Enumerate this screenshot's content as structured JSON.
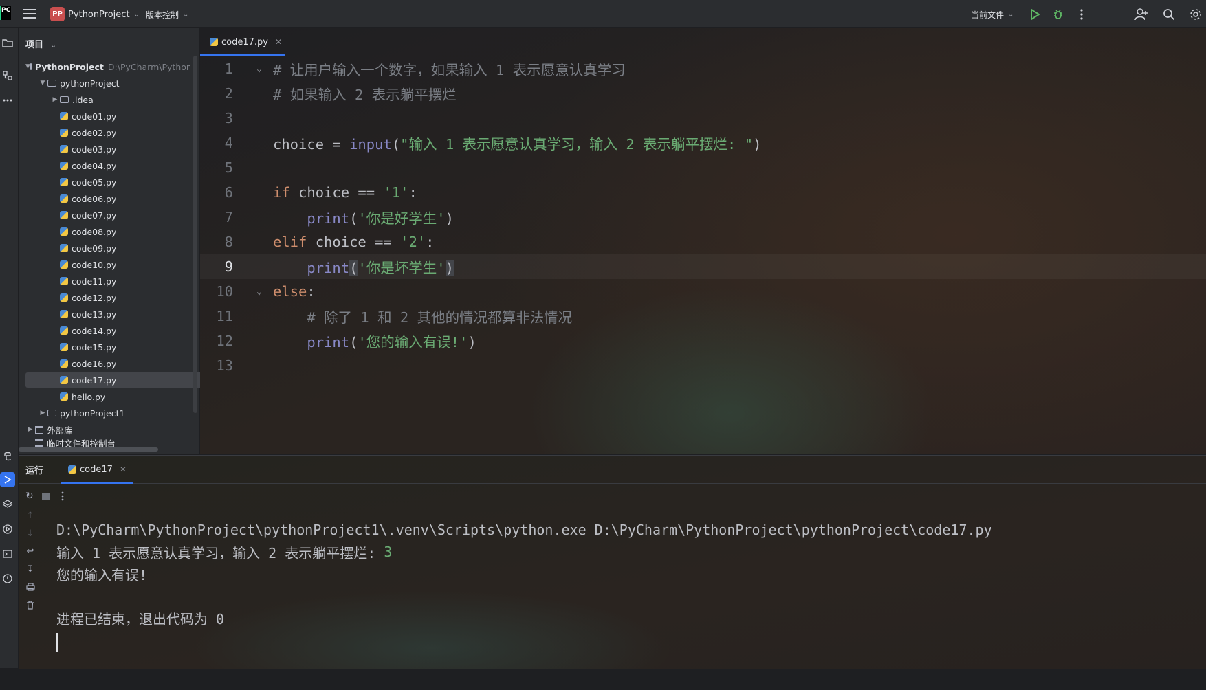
{
  "titlebar": {
    "logo": "PC",
    "project_badge": "PP",
    "project_name": "PythonProject",
    "vcs_label": "版本控制",
    "current_file_label": "当前文件",
    "icons": [
      "hamburger-menu-icon",
      "run-icon",
      "debug-icon",
      "more-vertical-icon",
      "add-user-icon",
      "search-icon",
      "settings-icon"
    ]
  },
  "project_panel": {
    "header": "项目",
    "root": {
      "name": "PythonProject",
      "path": "D:\\PyCharm\\PythonP"
    },
    "items": [
      {
        "label": "pythonProject",
        "kind": "folder",
        "expanded": true
      },
      {
        "label": ".idea",
        "kind": "folder",
        "expanded": false
      },
      {
        "label": "code01.py",
        "kind": "py"
      },
      {
        "label": "code02.py",
        "kind": "py"
      },
      {
        "label": "code03.py",
        "kind": "py"
      },
      {
        "label": "code04.py",
        "kind": "py"
      },
      {
        "label": "code05.py",
        "kind": "py"
      },
      {
        "label": "code06.py",
        "kind": "py"
      },
      {
        "label": "code07.py",
        "kind": "py"
      },
      {
        "label": "code08.py",
        "kind": "py"
      },
      {
        "label": "code09.py",
        "kind": "py"
      },
      {
        "label": "code10.py",
        "kind": "py"
      },
      {
        "label": "code11.py",
        "kind": "py"
      },
      {
        "label": "code12.py",
        "kind": "py"
      },
      {
        "label": "code13.py",
        "kind": "py"
      },
      {
        "label": "code14.py",
        "kind": "py"
      },
      {
        "label": "code15.py",
        "kind": "py"
      },
      {
        "label": "code16.py",
        "kind": "py"
      },
      {
        "label": "code17.py",
        "kind": "py",
        "selected": true
      },
      {
        "label": "hello.py",
        "kind": "py"
      },
      {
        "label": "pythonProject1",
        "kind": "folder",
        "expanded": false
      },
      {
        "label": "外部库",
        "kind": "library",
        "expanded": false
      },
      {
        "label": "临时文件和控制台",
        "kind": "scratch"
      }
    ]
  },
  "editor": {
    "tab_label": "code17.py",
    "current_line": 9,
    "lines": [
      {
        "n": "1",
        "text": "# 让用户输入一个数字，如果输入 1 表示愿意认真学习"
      },
      {
        "n": "2",
        "text": "# 如果输入 2 表示躺平摆烂"
      },
      {
        "n": "3",
        "text": ""
      },
      {
        "n": "4",
        "var": "choice",
        "op": " = ",
        "fn": "input",
        "open": "(",
        "str": "\"输入 1 表示愿意认真学习，输入 2 表示躺平摆烂: \"",
        "close": ")"
      },
      {
        "n": "5",
        "text": ""
      },
      {
        "n": "6",
        "kw": "if",
        "rest": " choice == ",
        "str": "'1'",
        "tail": ":"
      },
      {
        "n": "7",
        "indent": "    ",
        "fn": "print",
        "open": "(",
        "str": "'你是好学生'",
        "close": ")"
      },
      {
        "n": "8",
        "kw": "elif",
        "rest": " choice == ",
        "str": "'2'",
        "tail": ":"
      },
      {
        "n": "9",
        "indent": "    ",
        "fn": "print",
        "open": "(",
        "str": "'你是坏学生'",
        "close": ")"
      },
      {
        "n": "10",
        "kw": "else",
        "tail": ":"
      },
      {
        "n": "11",
        "text": "    # 除了 1 和 2 其他的情况都算非法情况"
      },
      {
        "n": "12",
        "indent": "    ",
        "fn": "print",
        "open": "(",
        "str": "'您的输入有误!'",
        "close": ")"
      },
      {
        "n": "13",
        "text": ""
      }
    ]
  },
  "run_panel": {
    "title": "运行",
    "tab_label": "code17",
    "console": {
      "command": "D:\\PyCharm\\PythonProject\\pythonProject1\\.venv\\Scripts\\python.exe D:\\PyCharm\\PythonProject\\pythonProject\\code17.py",
      "prompt": "输入 1 表示愿意认真学习，输入 2 表示躺平摆烂: ",
      "user_input": "3",
      "output": "您的输入有误!",
      "exit_message": "进程已结束，退出代码为 0"
    }
  },
  "colors": {
    "accent": "#3574f0",
    "keyword": "#cf8e6d",
    "string": "#6aab73",
    "builtin": "#8888c6",
    "comment": "#7a7e85"
  }
}
